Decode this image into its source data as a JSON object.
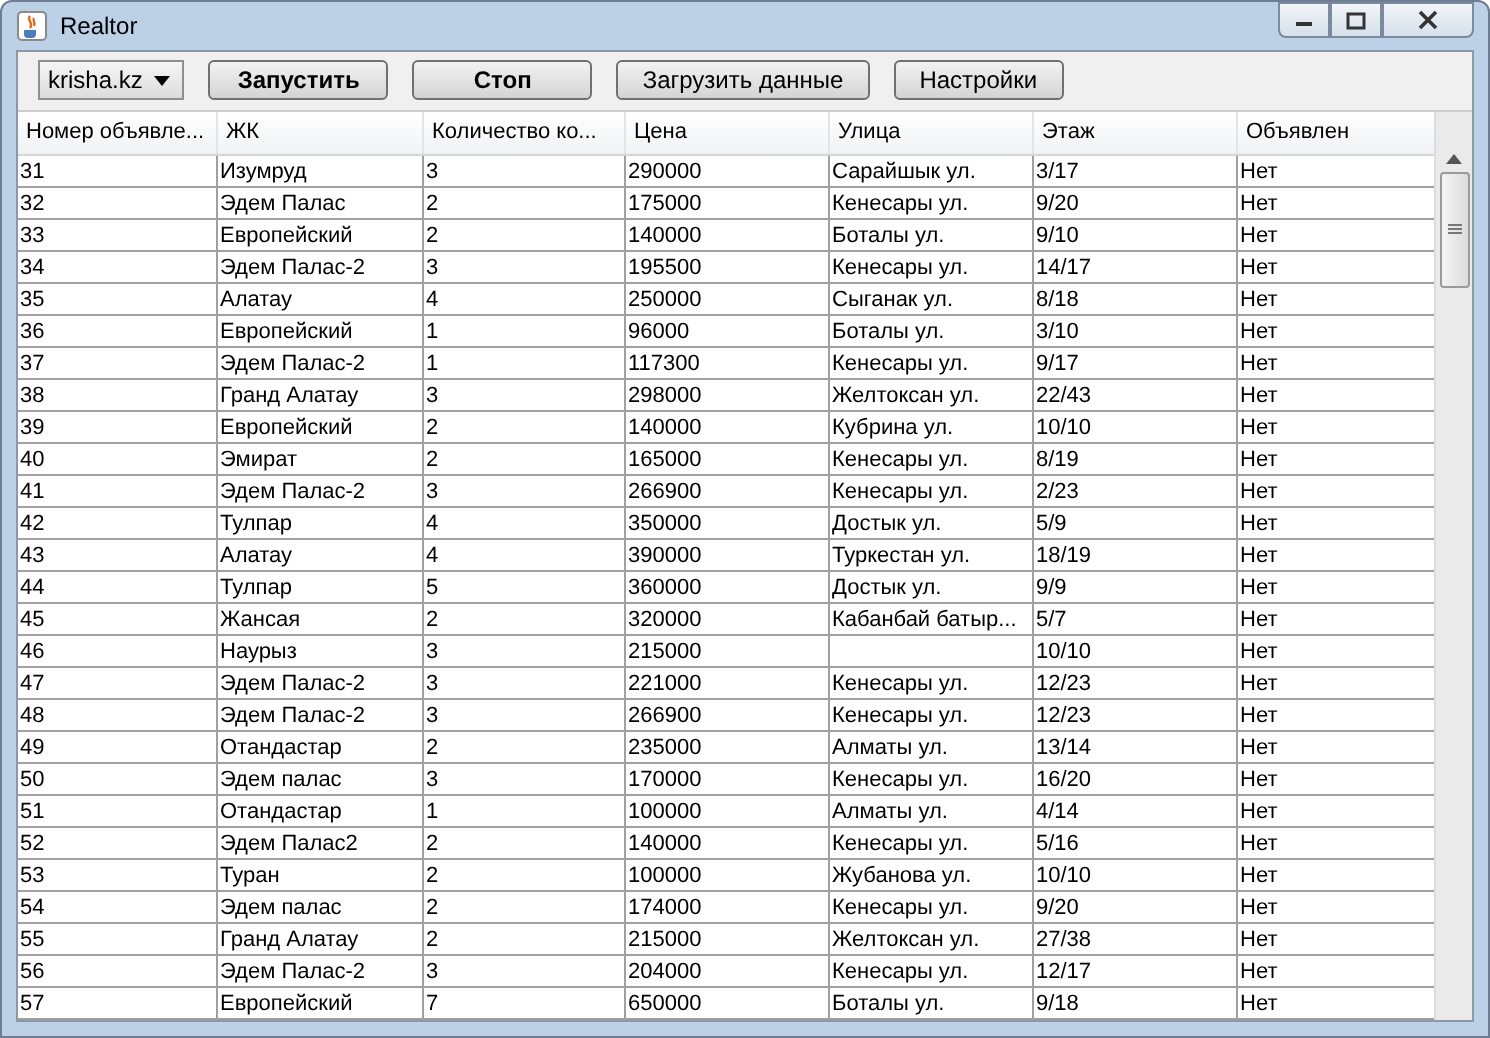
{
  "window": {
    "title": "Realtor"
  },
  "toolbar": {
    "site_select": "krisha.kz",
    "buttons": [
      {
        "label": "Запустить",
        "bold": true
      },
      {
        "label": "Стоп",
        "bold": true
      },
      {
        "label": "Загрузить данные",
        "bold": false
      },
      {
        "label": "Настройки",
        "bold": false
      }
    ]
  },
  "table": {
    "columns": [
      "Номер объявле...",
      "ЖК",
      "Количество ко...",
      "Цена",
      "Улица",
      "Этаж",
      "Объявлен"
    ],
    "rows": [
      [
        "31",
        "Изумруд",
        "3",
        "290000",
        "Сарайшык ул.",
        "3/17",
        "Нет"
      ],
      [
        "32",
        "Эдем Палас",
        "2",
        "175000",
        "Кенесары ул.",
        "9/20",
        "Нет"
      ],
      [
        "33",
        "Европейский",
        "2",
        "140000",
        "Боталы ул.",
        "9/10",
        "Нет"
      ],
      [
        "34",
        "Эдем Палас-2",
        "3",
        "195500",
        "Кенесары ул.",
        "14/17",
        "Нет"
      ],
      [
        "35",
        "Алатау",
        "4",
        "250000",
        "Сыганак ул.",
        "8/18",
        "Нет"
      ],
      [
        "36",
        "Европейский",
        "1",
        "96000",
        "Боталы ул.",
        "3/10",
        "Нет"
      ],
      [
        "37",
        "Эдем Палас-2",
        "1",
        "117300",
        "Кенесары ул.",
        "9/17",
        "Нет"
      ],
      [
        "38",
        "Гранд Алатау",
        "3",
        "298000",
        "Желтоксан ул.",
        "22/43",
        "Нет"
      ],
      [
        "39",
        "Европейский",
        "2",
        "140000",
        "Кубрина ул.",
        "10/10",
        "Нет"
      ],
      [
        "40",
        "Эмират",
        "2",
        "165000",
        "Кенесары ул.",
        "8/19",
        "Нет"
      ],
      [
        "41",
        "Эдем Палас-2",
        "3",
        "266900",
        "Кенесары ул.",
        "2/23",
        "Нет"
      ],
      [
        "42",
        "Тулпар",
        "4",
        "350000",
        "Достык ул.",
        "5/9",
        "Нет"
      ],
      [
        "43",
        "Алатау",
        "4",
        "390000",
        "Туркестан ул.",
        "18/19",
        "Нет"
      ],
      [
        "44",
        "Тулпар",
        "5",
        "360000",
        "Достык ул.",
        "9/9",
        "Нет"
      ],
      [
        "45",
        "Жансая",
        "2",
        "320000",
        "Кабанбай батыр...",
        "5/7",
        "Нет"
      ],
      [
        "46",
        "Наурыз",
        "3",
        "215000",
        null,
        "10/10",
        "Нет"
      ],
      [
        "47",
        "Эдем Палас-2",
        "3",
        "221000",
        "Кенесары ул.",
        "12/23",
        "Нет"
      ],
      [
        "48",
        "Эдем Палас-2",
        "3",
        "266900",
        "Кенесары ул.",
        "12/23",
        "Нет"
      ],
      [
        "49",
        "Отандастар",
        "2",
        "235000",
        "Алматы ул.",
        "13/14",
        "Нет"
      ],
      [
        "50",
        "Эдем палас",
        "3",
        "170000",
        "Кенесары ул.",
        "16/20",
        "Нет"
      ],
      [
        "51",
        "Отандастар",
        "1",
        "100000",
        "Алматы ул.",
        "4/14",
        "Нет"
      ],
      [
        "52",
        "Эдем Палас2",
        "2",
        "140000",
        "Кенесары ул.",
        "5/16",
        "Нет"
      ],
      [
        "53",
        "Туран",
        "2",
        "100000",
        "Жубанова ул.",
        "10/10",
        "Нет"
      ],
      [
        "54",
        "Эдем палас",
        "2",
        "174000",
        "Кенесары ул.",
        "9/20",
        "Нет"
      ],
      [
        "55",
        "Гранд Алатау",
        "2",
        "215000",
        "Желтоксан ул.",
        "27/38",
        "Нет"
      ],
      [
        "56",
        "Эдем Палас-2",
        "3",
        "204000",
        "Кенесары ул.",
        "12/17",
        "Нет"
      ],
      [
        "57",
        "Европейский",
        "7",
        "650000",
        "Боталы ул.",
        "9/18",
        "Нет"
      ]
    ]
  }
}
